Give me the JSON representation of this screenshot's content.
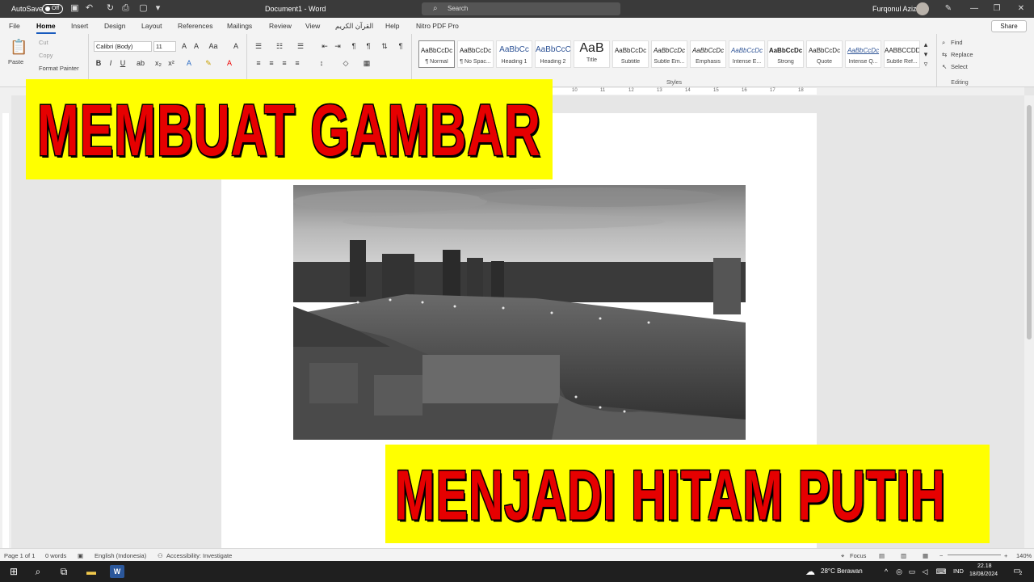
{
  "titlebar": {
    "autosave_label": "AutoSave",
    "autosave_state": "Off",
    "document_title": "Document1  -  Word",
    "search_placeholder": "Search",
    "user_name": "Furqonul Aziz"
  },
  "menu": {
    "tabs": [
      "File",
      "Home",
      "Insert",
      "Design",
      "Layout",
      "References",
      "Mailings",
      "Review",
      "View",
      "القرآن الكريم",
      "Help",
      "Nitro PDF Pro"
    ],
    "active_tab": "Home",
    "share_label": "Share"
  },
  "ribbon": {
    "clipboard": {
      "paste": "Paste",
      "cut": "Cut",
      "copy": "Copy",
      "format_painter": "Format Painter"
    },
    "font": {
      "font_name": "Calibri (Body)",
      "font_size": "11"
    },
    "styles": {
      "label": "Styles",
      "items": [
        {
          "preview": "AaBbCcDc",
          "name": "¶ Normal"
        },
        {
          "preview": "AaBbCcDc",
          "name": "¶ No Spac..."
        },
        {
          "preview": "AaBbCc",
          "name": "Heading 1"
        },
        {
          "preview": "AaBbCcC",
          "name": "Heading 2"
        },
        {
          "preview": "AaB",
          "name": "Title"
        },
        {
          "preview": "AaBbCcDc",
          "name": "Subtitle"
        },
        {
          "preview": "AaBbCcDc",
          "name": "Subtle Em..."
        },
        {
          "preview": "AaBbCcDc",
          "name": "Emphasis"
        },
        {
          "preview": "AaBbCcDc",
          "name": "Intense E..."
        },
        {
          "preview": "AaBbCcDc",
          "name": "Strong"
        },
        {
          "preview": "AaBbCcDc",
          "name": "Quote"
        },
        {
          "preview": "AaBbCcDc",
          "name": "Intense Q..."
        },
        {
          "preview": "AABBCCDD",
          "name": "Subtle Ref..."
        }
      ]
    },
    "editing": {
      "label": "Editing",
      "find": "Find",
      "replace": "Replace",
      "select": "Select"
    }
  },
  "ruler": {
    "marks": [
      "10",
      "11",
      "12",
      "13",
      "14",
      "15",
      "16",
      "17",
      "18"
    ]
  },
  "overlay": {
    "line1": "MEMBUAT GAMBAR",
    "line2": "MENJADI HITAM PUTIH",
    "background_color": "#ffff00",
    "text_color": "#e60000"
  },
  "statusbar": {
    "page": "Page 1 of 1",
    "words": "0 words",
    "language": "English (Indonesia)",
    "accessibility": "Accessibility: Investigate",
    "focus": "Focus",
    "zoom": "140%"
  },
  "taskbar": {
    "weather": "28°C  Berawan",
    "lang": "IND",
    "time": "22.18",
    "date": "18/08/2024",
    "notifications": "2"
  }
}
